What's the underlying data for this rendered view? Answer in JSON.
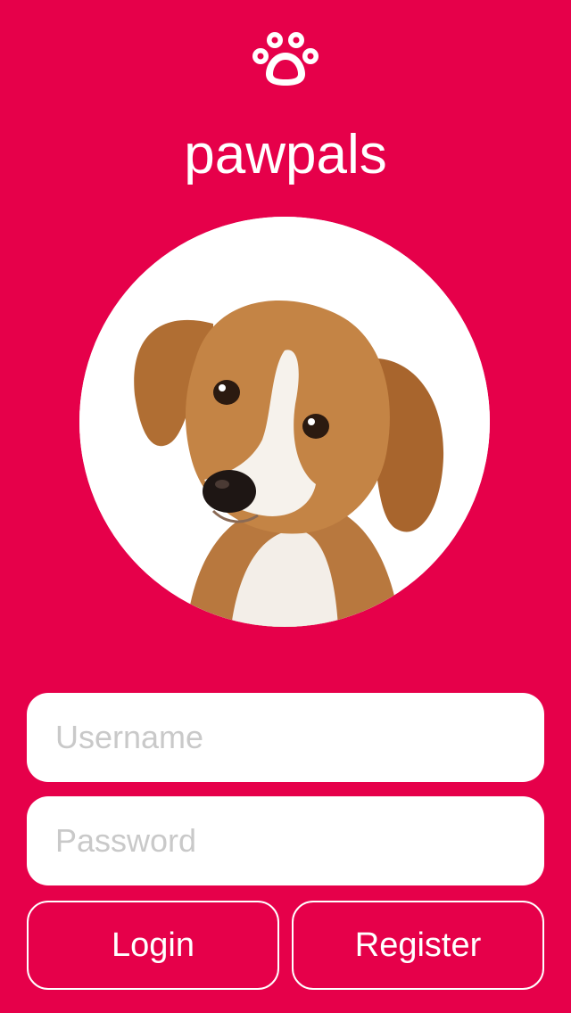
{
  "app": {
    "title": "pawpals",
    "logo_icon": "paw-icon",
    "background_color": "#E6004A"
  },
  "hero": {
    "image": "puppy-photo"
  },
  "form": {
    "username": {
      "placeholder": "Username",
      "value": ""
    },
    "password": {
      "placeholder": "Password",
      "value": ""
    }
  },
  "actions": {
    "login_label": "Login",
    "register_label": "Register"
  }
}
